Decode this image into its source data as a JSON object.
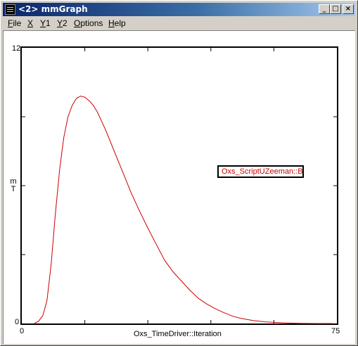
{
  "window": {
    "title": "<2> mmGraph"
  },
  "titlebar_buttons": {
    "minimize": "_",
    "maximize": "□",
    "close": "×"
  },
  "menu": {
    "items": [
      {
        "label": "File",
        "accel": "F",
        "rest": "ile"
      },
      {
        "label": "X",
        "accel": "X",
        "rest": ""
      },
      {
        "label": "Y1",
        "accel": "Y",
        "rest": "1"
      },
      {
        "label": "Y2",
        "accel": "Y",
        "rest": "2"
      },
      {
        "label": "Options",
        "accel": "O",
        "rest": "ptions"
      },
      {
        "label": "Help",
        "accel": "H",
        "rest": "elp"
      }
    ]
  },
  "colors": {
    "curve": "#cc0000",
    "titlebar_start": "#0a246a",
    "titlebar_end": "#a6caf0"
  },
  "chart_data": {
    "type": "line",
    "xlabel": "Oxs_TimeDriver::Iteration",
    "ylabel": "mT",
    "xlim": [
      0,
      75
    ],
    "ylim": [
      0,
      12
    ],
    "x_tick_labels": [
      "0",
      "75"
    ],
    "y_tick_labels": [
      "0",
      "12"
    ],
    "grid": false,
    "legend": "Oxs_ScriptUZeeman::B",
    "legend_position": "upper-right",
    "series": [
      {
        "name": "Oxs_ScriptUZeeman::B",
        "x": [
          3,
          4,
          5,
          6,
          7,
          8,
          9,
          10,
          11,
          12,
          13,
          14,
          15,
          16,
          17,
          18,
          20,
          22,
          24,
          26,
          28,
          30,
          32,
          34,
          36,
          38,
          40,
          42,
          44,
          46,
          48,
          50,
          52,
          55,
          58,
          62,
          66,
          70,
          74
        ],
        "y": [
          0.0,
          0.1,
          0.35,
          1.0,
          2.6,
          4.8,
          6.7,
          8.1,
          9.0,
          9.5,
          9.8,
          9.9,
          9.85,
          9.7,
          9.5,
          9.2,
          8.4,
          7.5,
          6.6,
          5.7,
          4.9,
          4.15,
          3.45,
          2.75,
          2.25,
          1.85,
          1.45,
          1.1,
          0.85,
          0.65,
          0.48,
          0.33,
          0.23,
          0.13,
          0.07,
          0.03,
          0.01,
          0.0,
          0.0
        ]
      }
    ]
  }
}
